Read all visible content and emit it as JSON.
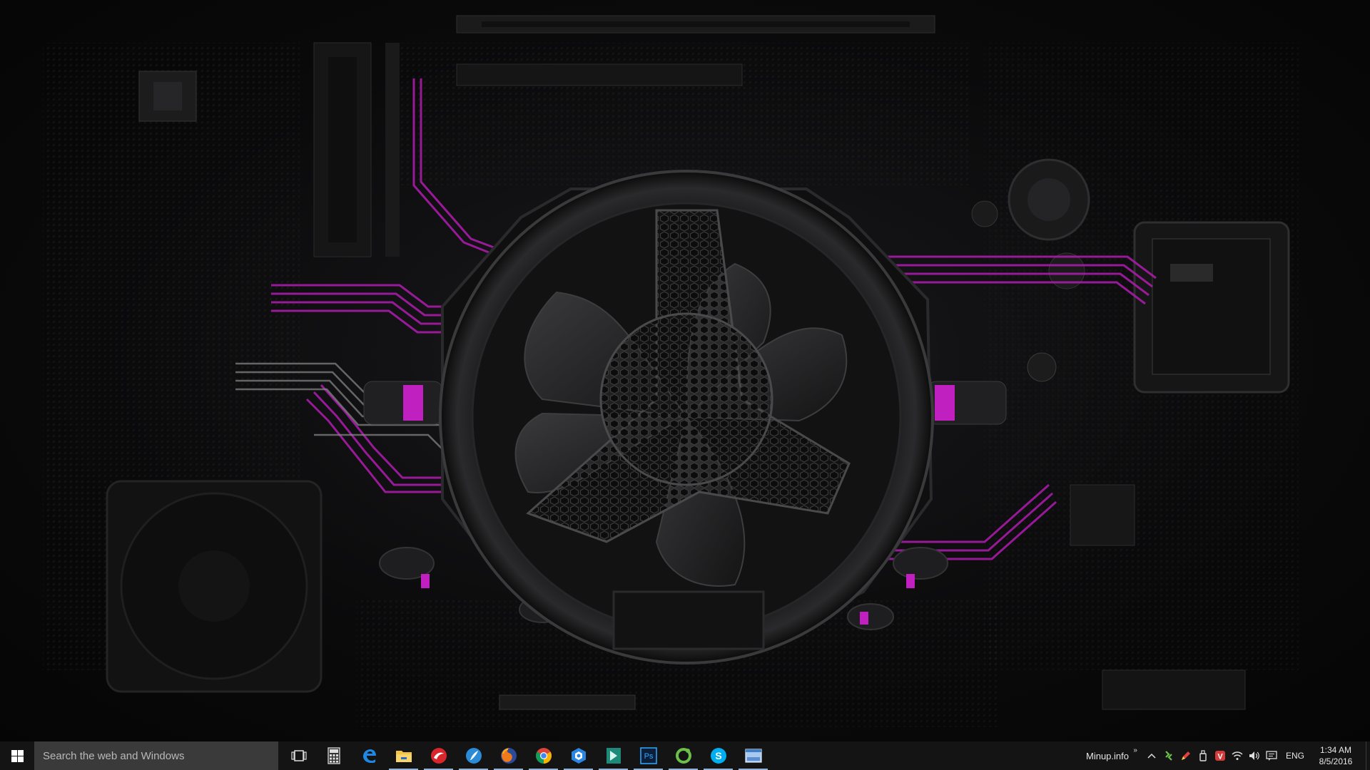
{
  "colors": {
    "accent": "#c020c0",
    "taskbar": "#141414",
    "search_bg": "#3a3a3a",
    "running_indicator": "#8fb3d9"
  },
  "wallpaper": {
    "description_icon": "motherboard-fan-wallpaper"
  },
  "taskbar": {
    "search_placeholder": "Search the web and Windows",
    "pinned": [
      {
        "name": "task-view",
        "icon": "task-view-icon",
        "running": false
      },
      {
        "name": "calculator",
        "icon": "calculator-icon",
        "running": false
      },
      {
        "name": "edge",
        "icon": "edge-icon",
        "running": false
      },
      {
        "name": "file-explorer",
        "icon": "folder-icon",
        "running": true
      },
      {
        "name": "app-red",
        "icon": "red-swirl-icon",
        "running": true
      },
      {
        "name": "app-blue",
        "icon": "blue-feather-icon",
        "running": true
      },
      {
        "name": "firefox",
        "icon": "firefox-icon",
        "running": true
      },
      {
        "name": "chrome",
        "icon": "chrome-icon",
        "running": true
      },
      {
        "name": "app-hex",
        "icon": "blue-hexagon-icon",
        "running": true
      },
      {
        "name": "app-teal",
        "icon": "teal-arrow-icon",
        "running": true
      },
      {
        "name": "photoshop",
        "icon": "photoshop-icon",
        "running": true
      },
      {
        "name": "app-green",
        "icon": "green-ring-icon",
        "running": true
      },
      {
        "name": "skype",
        "icon": "skype-icon",
        "running": true
      },
      {
        "name": "app-window",
        "icon": "window-icon",
        "running": true
      }
    ],
    "photoshop_label": "Ps",
    "skype_label": "S"
  },
  "tray": {
    "toolbar_label": "Minup.info",
    "toolbar_chevron": "»",
    "overflow_chevron": "^",
    "language": "ENG",
    "time": "1:34 AM",
    "date": "8/5/2016",
    "icons": [
      "network-share-icon",
      "pen-icon",
      "usb-icon",
      "vivaldi-icon",
      "wifi-icon",
      "volume-icon",
      "notifications-icon"
    ],
    "vivaldi_label": "V"
  }
}
